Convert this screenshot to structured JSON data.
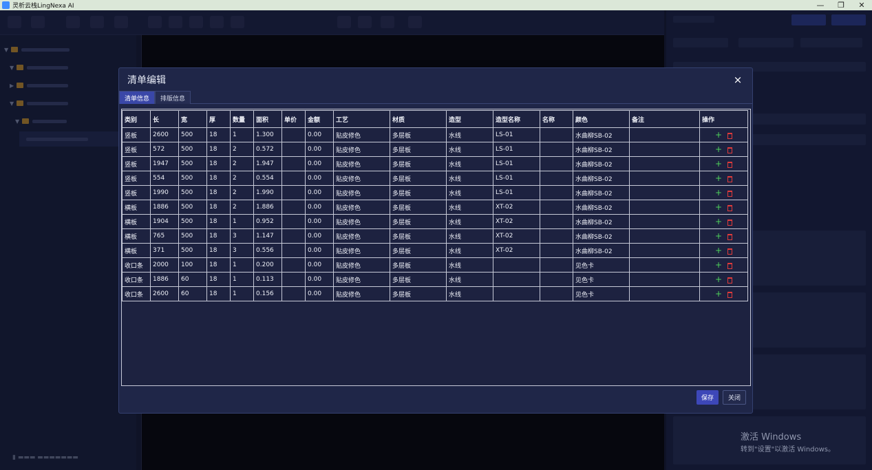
{
  "window": {
    "title": "灵析云栈LingNexa AI",
    "minimize": "—",
    "restore": "❐",
    "close": "✕"
  },
  "dialog": {
    "title": "清单编辑",
    "close_glyph": "×",
    "tabs": [
      {
        "label": "清单信息",
        "active": true
      },
      {
        "label": "排版信息",
        "active": false
      }
    ],
    "columns": [
      "类别",
      "长",
      "宽",
      "厚",
      "数量",
      "面积",
      "单价",
      "金额",
      "工艺",
      "材质",
      "造型",
      "造型名称",
      "名称",
      "颜色",
      "备注",
      "操作"
    ],
    "rows": [
      [
        "竖板",
        "2600",
        "500",
        "18",
        "1",
        "1.300",
        "",
        "0.00",
        "贴皮修色",
        "多层板",
        "水线",
        "LS-01",
        "",
        "水曲柳SB-02",
        ""
      ],
      [
        "竖板",
        "572",
        "500",
        "18",
        "2",
        "0.572",
        "",
        "0.00",
        "贴皮修色",
        "多层板",
        "水线",
        "LS-01",
        "",
        "水曲柳SB-02",
        ""
      ],
      [
        "竖板",
        "1947",
        "500",
        "18",
        "2",
        "1.947",
        "",
        "0.00",
        "贴皮修色",
        "多层板",
        "水线",
        "LS-01",
        "",
        "水曲柳SB-02",
        ""
      ],
      [
        "竖板",
        "554",
        "500",
        "18",
        "2",
        "0.554",
        "",
        "0.00",
        "贴皮修色",
        "多层板",
        "水线",
        "LS-01",
        "",
        "水曲柳SB-02",
        ""
      ],
      [
        "竖板",
        "1990",
        "500",
        "18",
        "2",
        "1.990",
        "",
        "0.00",
        "贴皮修色",
        "多层板",
        "水线",
        "LS-01",
        "",
        "水曲柳SB-02",
        ""
      ],
      [
        "横板",
        "1886",
        "500",
        "18",
        "2",
        "1.886",
        "",
        "0.00",
        "贴皮修色",
        "多层板",
        "水线",
        "XT-02",
        "",
        "水曲柳SB-02",
        ""
      ],
      [
        "横板",
        "1904",
        "500",
        "18",
        "1",
        "0.952",
        "",
        "0.00",
        "贴皮修色",
        "多层板",
        "水线",
        "XT-02",
        "",
        "水曲柳SB-02",
        ""
      ],
      [
        "横板",
        "765",
        "500",
        "18",
        "3",
        "1.147",
        "",
        "0.00",
        "贴皮修色",
        "多层板",
        "水线",
        "XT-02",
        "",
        "水曲柳SB-02",
        ""
      ],
      [
        "横板",
        "371",
        "500",
        "18",
        "3",
        "0.556",
        "",
        "0.00",
        "贴皮修色",
        "多层板",
        "水线",
        "XT-02",
        "",
        "水曲柳SB-02",
        ""
      ],
      [
        "收口条",
        "2000",
        "100",
        "18",
        "1",
        "0.200",
        "",
        "0.00",
        "贴皮修色",
        "多层板",
        "水线",
        "",
        "",
        "见色卡",
        ""
      ],
      [
        "收口条",
        "1886",
        "60",
        "18",
        "1",
        "0.113",
        "",
        "0.00",
        "贴皮修色",
        "多层板",
        "水线",
        "",
        "",
        "见色卡",
        ""
      ],
      [
        "收口条",
        "2600",
        "60",
        "18",
        "1",
        "0.156",
        "",
        "0.00",
        "贴皮修色",
        "多层板",
        "水线",
        "",
        "",
        "见色卡",
        ""
      ]
    ],
    "row_actions": {
      "add_icon": "+",
      "delete_icon": "trash-icon"
    },
    "buttons": {
      "save": "保存",
      "close": "关闭"
    }
  },
  "watermark": {
    "line1": "激活 Windows",
    "line2": "转到\"设置\"以激活 Windows。"
  },
  "colors": {
    "accent": "#3d47b8",
    "add": "#4fd35b",
    "delete": "#e03b3b",
    "dialog_bg": "#1f2648"
  }
}
